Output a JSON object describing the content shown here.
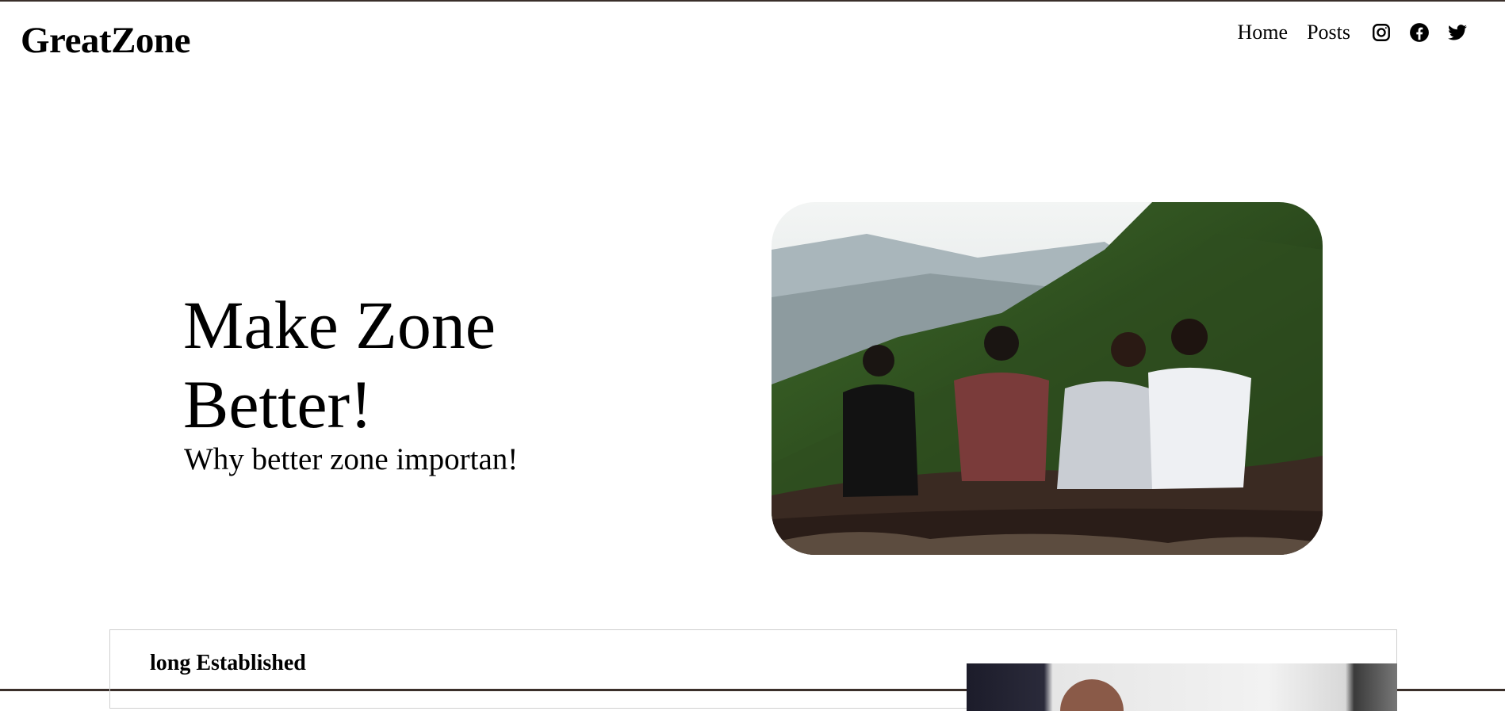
{
  "header": {
    "brand": "GreatZone",
    "nav": [
      {
        "label": "Home"
      },
      {
        "label": "Posts"
      }
    ],
    "social_icons": [
      "instagram-icon",
      "facebook-icon",
      "twitter-icon"
    ]
  },
  "hero": {
    "title": "Make Zone Better!",
    "subtitle": "Why better zone importan!",
    "image": "four-friends-sitting-on-mountain-photo"
  },
  "section": {
    "card_title": "long Established"
  },
  "colors": {
    "background": "#ffffff",
    "text": "#000000",
    "frame": "#3a2f2a",
    "card_border": "#cfcfcf"
  }
}
